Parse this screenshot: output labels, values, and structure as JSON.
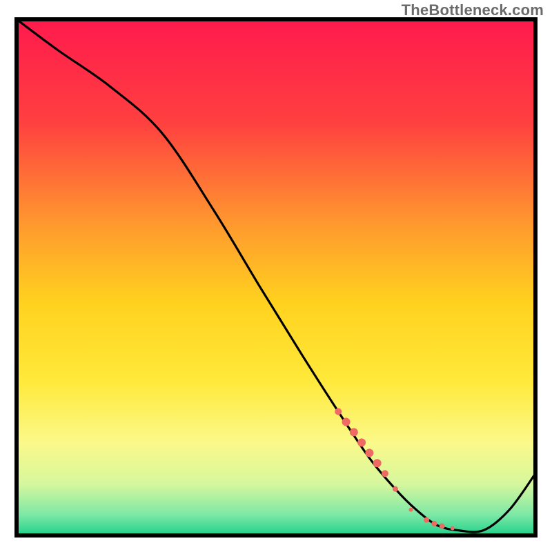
{
  "watermark": "TheBottleneck.com",
  "chart_data": {
    "type": "line",
    "title": "",
    "xlabel": "",
    "ylabel": "",
    "xlim": [
      0,
      100
    ],
    "ylim": [
      0,
      100
    ],
    "grid": false,
    "legend": false,
    "background_gradient_stops": [
      {
        "offset": 0.0,
        "color": "#ff1a4d"
      },
      {
        "offset": 0.2,
        "color": "#ff4040"
      },
      {
        "offset": 0.4,
        "color": "#ff9a2e"
      },
      {
        "offset": 0.55,
        "color": "#ffd21f"
      },
      {
        "offset": 0.7,
        "color": "#ffe93a"
      },
      {
        "offset": 0.82,
        "color": "#fbf98a"
      },
      {
        "offset": 0.9,
        "color": "#d6f79d"
      },
      {
        "offset": 0.96,
        "color": "#7de8a6"
      },
      {
        "offset": 1.0,
        "color": "#1fd18a"
      }
    ],
    "series": [
      {
        "name": "bottleneck-curve",
        "x": [
          0,
          8,
          18,
          28,
          38,
          47,
          55,
          62,
          68,
          73,
          77,
          81,
          85,
          90,
          95,
          100
        ],
        "y": [
          100,
          94,
          87,
          78,
          63,
          48,
          35,
          24,
          15,
          9,
          5,
          2,
          1,
          1,
          5,
          12
        ]
      }
    ],
    "highlight_points": {
      "name": "highlight-cluster",
      "color": "#ef6a63",
      "points": [
        {
          "x": 62,
          "y": 24,
          "r": 5
        },
        {
          "x": 63.5,
          "y": 22,
          "r": 6
        },
        {
          "x": 65,
          "y": 20,
          "r": 6
        },
        {
          "x": 66.5,
          "y": 18,
          "r": 6
        },
        {
          "x": 68,
          "y": 16,
          "r": 6
        },
        {
          "x": 69.5,
          "y": 14,
          "r": 6
        },
        {
          "x": 71,
          "y": 12,
          "r": 5
        },
        {
          "x": 73,
          "y": 9,
          "r": 4
        },
        {
          "x": 76,
          "y": 5,
          "r": 3
        },
        {
          "x": 79,
          "y": 3,
          "r": 4
        },
        {
          "x": 80.5,
          "y": 2.3,
          "r": 4
        },
        {
          "x": 82,
          "y": 1.8,
          "r": 4
        },
        {
          "x": 84,
          "y": 1.4,
          "r": 3
        }
      ]
    }
  }
}
